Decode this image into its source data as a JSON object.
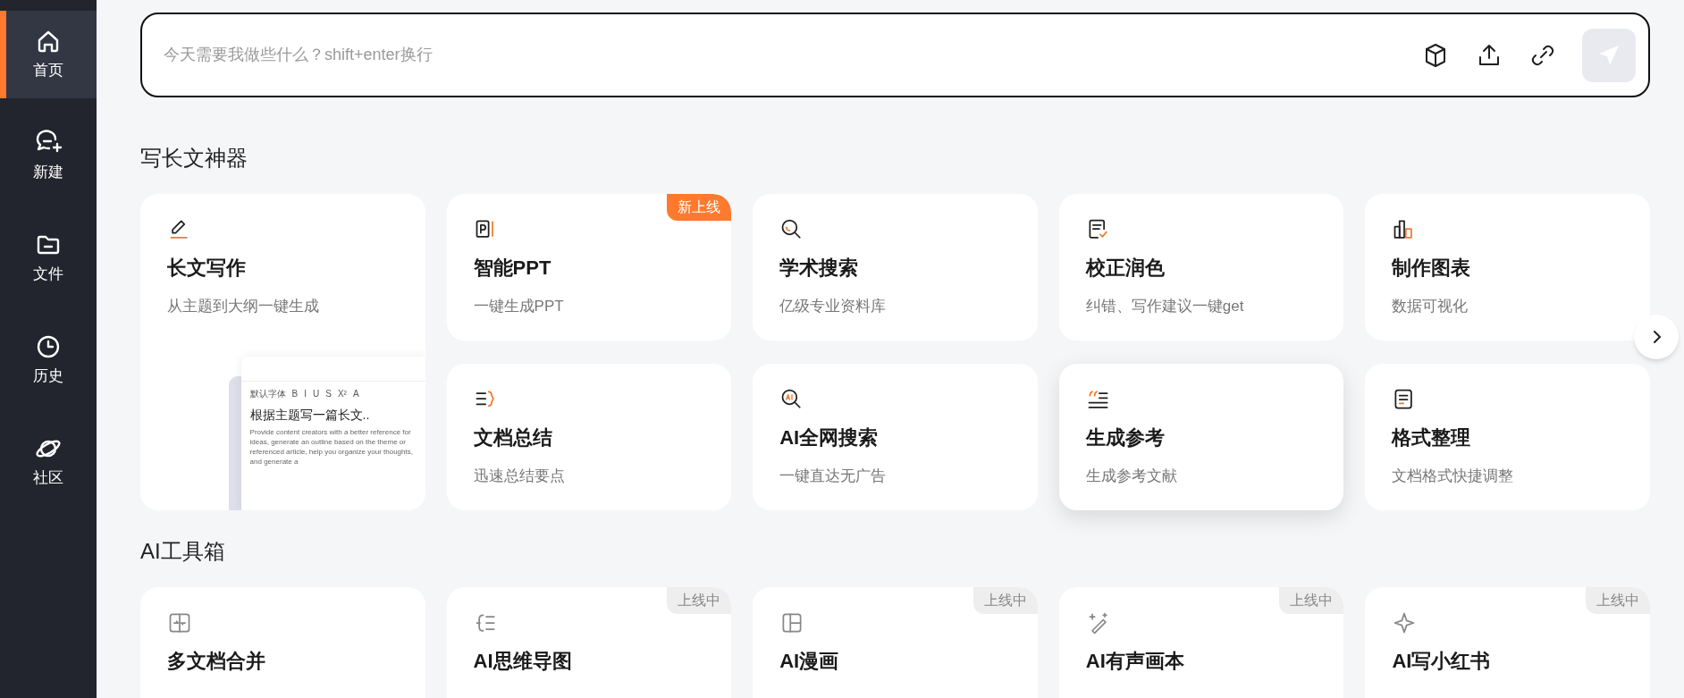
{
  "sidebar": {
    "items": [
      {
        "label": "首页",
        "selected": true
      },
      {
        "label": "新建",
        "selected": false
      },
      {
        "label": "文件",
        "selected": false
      },
      {
        "label": "历史",
        "selected": false
      },
      {
        "label": "社区",
        "selected": false
      }
    ]
  },
  "prompt": {
    "placeholder": "今天需要我做些什么？shift+enter换行",
    "send_disabled": true
  },
  "sections": [
    {
      "title": "写长文神器",
      "cards": [
        {
          "title": "长文写作",
          "subtitle": "从主题到大纲一键生成",
          "highlighted": false,
          "preview": {
            "toolbar": [
              "默认字体",
              "B",
              "I",
              "U",
              "S",
              "X²",
              "A"
            ],
            "heading": "根据主题写一篇长文..",
            "body": "Provide content creators with a better reference for ideas, generate an outline based on the theme or referenced article, help you organize your thoughts, and generate a"
          }
        },
        {
          "title": "智能PPT",
          "subtitle": "一键生成PPT",
          "highlighted": false,
          "badge": {
            "text": "新上线",
            "kind": "new"
          }
        },
        {
          "title": "学术搜索",
          "subtitle": "亿级专业资料库",
          "highlighted": false
        },
        {
          "title": "校正润色",
          "subtitle": "纠错、写作建议一键get",
          "highlighted": false
        },
        {
          "title": "制作图表",
          "subtitle": "数据可视化",
          "highlighted": false
        },
        {
          "title": "文档总结",
          "subtitle": "迅速总结要点",
          "highlighted": false
        },
        {
          "title": "AI全网搜索",
          "subtitle": "一键直达无广告",
          "highlighted": false
        },
        {
          "title": "生成参考",
          "subtitle": "生成参考文献",
          "highlighted": true
        },
        {
          "title": "格式整理",
          "subtitle": "文档格式快捷调整",
          "highlighted": false
        }
      ]
    },
    {
      "title": "AI工具箱",
      "cards": [
        {
          "title": "多文档合并",
          "highlighted": false
        },
        {
          "title": "AI思维导图",
          "highlighted": false,
          "badge": {
            "text": "上线中",
            "kind": "soon"
          }
        },
        {
          "title": "AI漫画",
          "highlighted": false,
          "badge": {
            "text": "上线中",
            "kind": "soon"
          }
        },
        {
          "title": "AI有声画本",
          "highlighted": false,
          "badge": {
            "text": "上线中",
            "kind": "soon"
          }
        },
        {
          "title": "AI写小红书",
          "highlighted": false,
          "badge": {
            "text": "上线中",
            "kind": "soon"
          }
        }
      ]
    }
  ]
}
